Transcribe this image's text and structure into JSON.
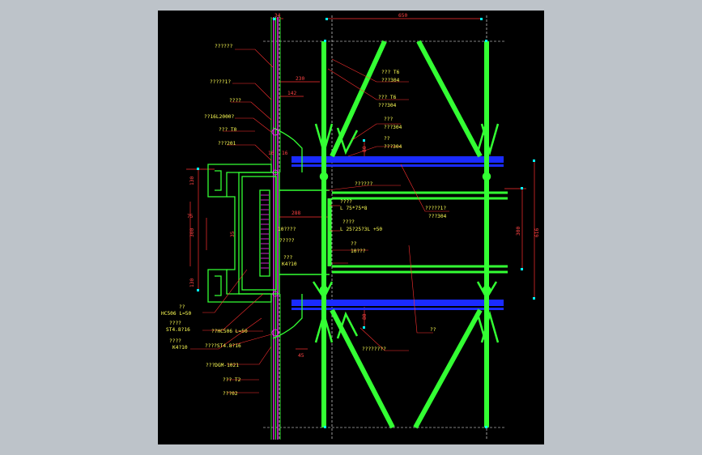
{
  "drawing": {
    "dimensions": {
      "top_34": "34",
      "top_650": "650",
      "d_230": "230",
      "d_142": "142",
      "d_80a": "80",
      "d_80b": "80",
      "d_16a": "16",
      "d_16b": "16",
      "d_45": "45",
      "d_288": "288",
      "left_130a": "130",
      "left_75": "75",
      "left_300": "300",
      "left_35": "35",
      "left_130b": "130",
      "right_300": "300",
      "right_616": "616"
    },
    "left_labels": [
      "??????",
      "?????1?",
      "????",
      "??16L2000?",
      "???  T0",
      "???201",
      "??",
      "HC506 L=50",
      "????",
      "ST4.8?16",
      "????",
      "K4?10",
      "??HC506 L=50",
      "????ST4.8?16",
      "???DGM-1021",
      "???  T2",
      "???02"
    ],
    "right_labels": [
      "???   T6",
      "???304",
      "???   T6",
      "???304",
      "???",
      "???304",
      "??",
      "???304",
      "??????",
      "????",
      "L  75*75*8",
      "????",
      "L  25?25?3L  +50",
      "?????1?",
      "???304",
      "??",
      "10???",
      "??",
      "????????"
    ],
    "center_labels": [
      "10????",
      "?????",
      "???",
      "K4?10"
    ]
  }
}
